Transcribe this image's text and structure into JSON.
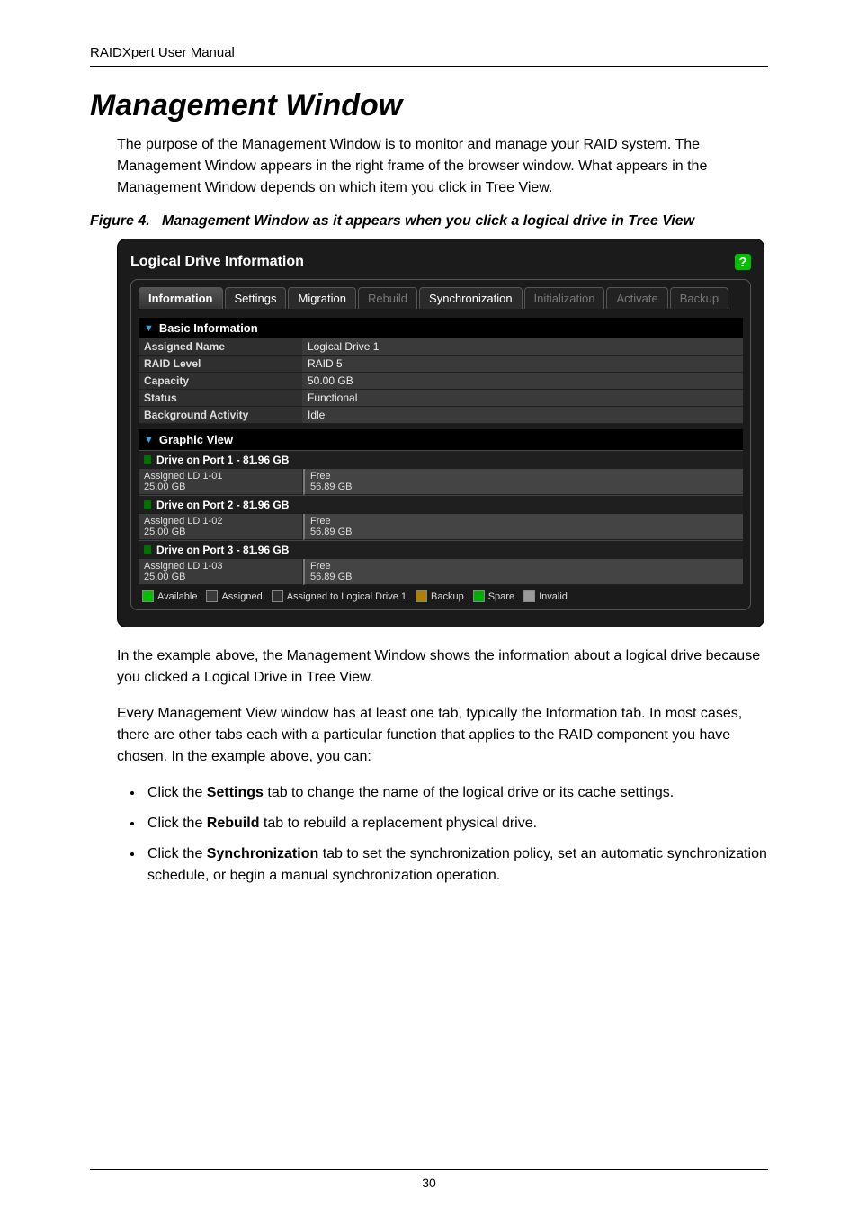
{
  "running_head": "RAIDXpert User Manual",
  "heading": "Management Window",
  "intro": "The purpose of the Management Window is to monitor and manage your RAID system. The Management Window appears in the right frame of the browser window. What appears in the Management Window depends on which item you click in Tree View.",
  "figure": {
    "number": "Figure 4.",
    "caption": "Management Window as it appears when you click a logical drive in Tree View"
  },
  "screenshot": {
    "panel_title": "Logical Drive Information",
    "help": "?",
    "tabs": [
      {
        "label": "Information",
        "state": "active"
      },
      {
        "label": "Settings",
        "state": "enabled"
      },
      {
        "label": "Migration",
        "state": "enabled"
      },
      {
        "label": "Rebuild",
        "state": "disabled"
      },
      {
        "label": "Synchronization",
        "state": "enabled"
      },
      {
        "label": "Initialization",
        "state": "disabled"
      },
      {
        "label": "Activate",
        "state": "disabled"
      },
      {
        "label": "Backup",
        "state": "disabled"
      }
    ],
    "basic_info_heading": "Basic Information",
    "basic_info": [
      {
        "k": "Assigned Name",
        "v": "Logical Drive 1"
      },
      {
        "k": "RAID Level",
        "v": "RAID 5"
      },
      {
        "k": "Capacity",
        "v": "50.00 GB"
      },
      {
        "k": "Status",
        "v": "Functional"
      },
      {
        "k": "Background Activity",
        "v": "Idle"
      }
    ],
    "graphic_view_heading": "Graphic View",
    "drives": [
      {
        "title": "Drive on Port 1 - 81.96 GB",
        "assigned_line1": "Assigned LD 1-01",
        "assigned_line2": "25.00 GB",
        "free_line1": "Free",
        "free_line2": "56.89 GB"
      },
      {
        "title": "Drive on Port 2 - 81.96 GB",
        "assigned_line1": "Assigned LD 1-02",
        "assigned_line2": "25.00 GB",
        "free_line1": "Free",
        "free_line2": "56.89 GB"
      },
      {
        "title": "Drive on Port 3 - 81.96 GB",
        "assigned_line1": "Assigned LD 1-03",
        "assigned_line2": "25.00 GB",
        "free_line1": "Free",
        "free_line2": "56.89 GB"
      }
    ],
    "legend": {
      "available": "Available",
      "assigned": "Assigned",
      "assigned_ld1": "Assigned to Logical Drive 1",
      "backup": "Backup",
      "spare": "Spare",
      "invalid": "Invalid"
    }
  },
  "para_after_figure_1": "In the example above, the Management Window shows the information about a logical drive because you clicked a Logical Drive in Tree View.",
  "para_after_figure_2": "Every Management View window has at least one tab, typically the Information tab. In most cases, there are other tabs each with a particular function that applies to the RAID component you have chosen. In the example above, you can:",
  "bullets": [
    {
      "lead": "Click the ",
      "bold": "Settings",
      "rest": " tab to change the name of the logical drive or its cache settings."
    },
    {
      "lead": "Click the ",
      "bold": "Rebuild",
      "rest": " tab to rebuild a replacement physical drive."
    },
    {
      "lead": "Click the ",
      "bold": "Synchronization",
      "rest": " tab to set the synchronization policy, set an automatic synchronization schedule, or begin a manual synchronization operation."
    }
  ],
  "page_number": "30"
}
